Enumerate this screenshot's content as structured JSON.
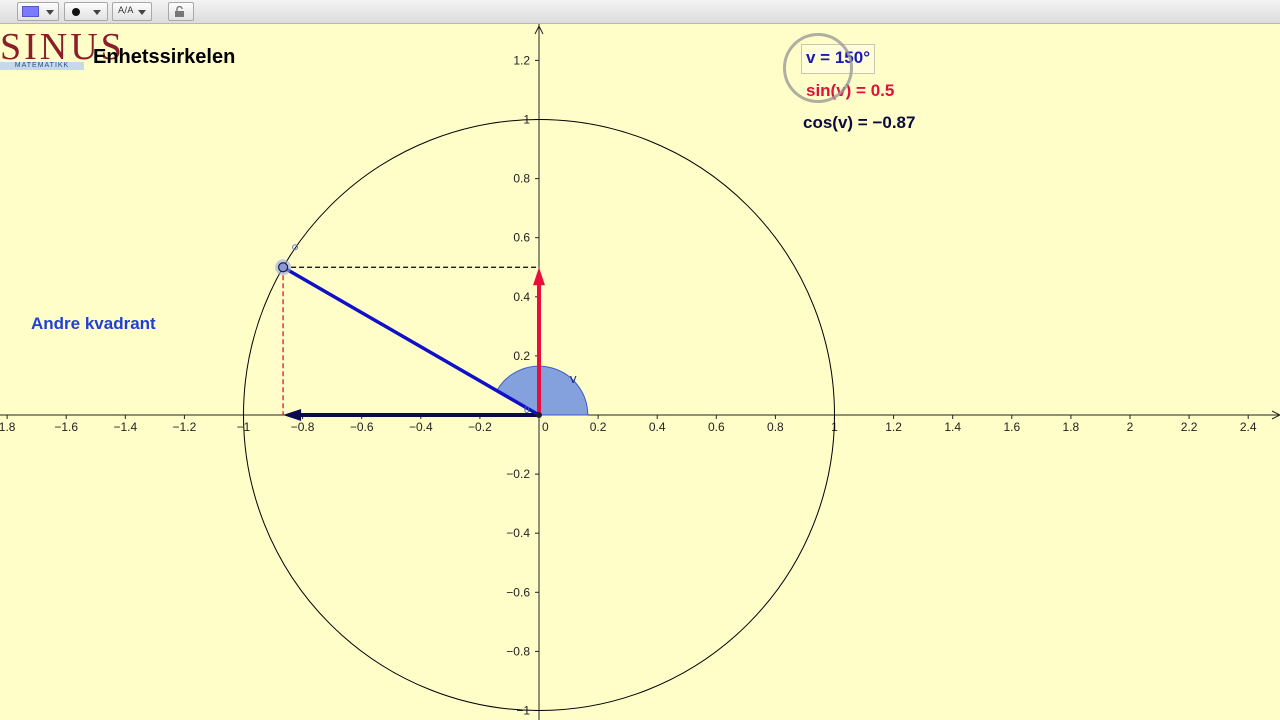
{
  "toolbar": {
    "color_swatch": "#7b7bff",
    "font_size_label": "A/A"
  },
  "logo": {
    "text": "SINUS",
    "subtitle": "MATEMATIKK"
  },
  "page_title": "Enhetssirkelen",
  "quadrant_label": "Andre kvadrant",
  "values": {
    "v_label": "v = 150°",
    "sin_label": "sin(v) = 0.5",
    "cos_label": "cos(v) = −0.87",
    "angle_mark": "v",
    "origin_label": "0"
  },
  "angle_deg": 150,
  "axes": {
    "x_ticks": [
      "1.8",
      "−1.6",
      "−1.4",
      "−1.2",
      "−1",
      "−0.8",
      "−0.6",
      "−0.4",
      "−0.2",
      "0",
      "0.2",
      "0.4",
      "0.6",
      "0.8",
      "1",
      "1.2",
      "1.4",
      "1.6",
      "1.8",
      "2",
      "2.2",
      "2.4"
    ],
    "x_values": [
      -1.8,
      -1.6,
      -1.4,
      -1.2,
      -1,
      -0.8,
      -0.6,
      -0.4,
      -0.2,
      0,
      0.2,
      0.4,
      0.6,
      0.8,
      1,
      1.2,
      1.4,
      1.6,
      1.8,
      2,
      2.2,
      2.4
    ],
    "y_ticks": [
      "1.2",
      "1",
      "0.8",
      "0.6",
      "0.4",
      "0.2",
      "−0.2",
      "−0.4",
      "−0.6",
      "−0.8",
      "−1"
    ],
    "y_values": [
      1.2,
      1,
      0.8,
      0.6,
      0.4,
      0.2,
      -0.2,
      -0.4,
      -0.6,
      -0.8,
      -1
    ]
  },
  "colors": {
    "background": "#fffec9",
    "radius_line": "#1010c8",
    "sin_arrow": "#e8103a",
    "cos_arrow": "#0a0a50",
    "angle_fill": "#6f8fe0",
    "circle": "#000000"
  }
}
